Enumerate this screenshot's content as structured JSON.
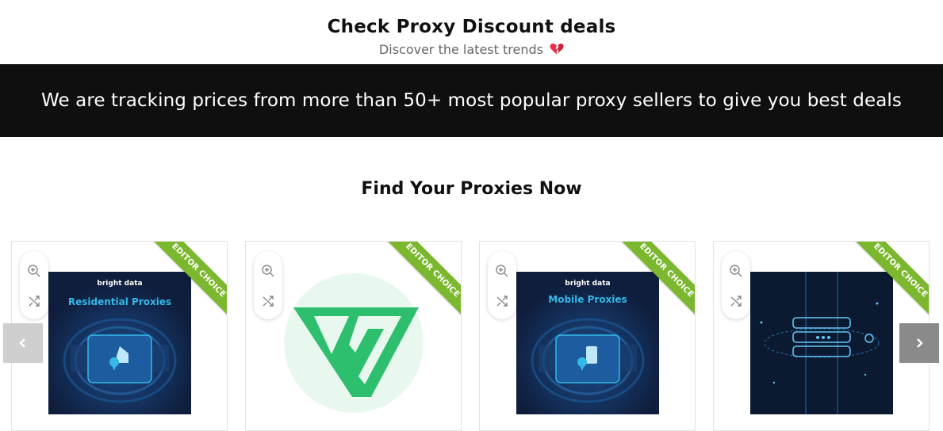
{
  "header": {
    "title": "Check Proxy Discount deals",
    "subtitle": "Discover the latest trends"
  },
  "banner": {
    "text": "We are tracking prices from more than 50+ most popular proxy sellers to give you best deals"
  },
  "section": {
    "title": "Find Your Proxies Now"
  },
  "products": [
    {
      "badge": "EDITOR CHOICE",
      "brand": "bright data",
      "label": "Residential Proxies",
      "image": "bright-data-residential-proxies"
    },
    {
      "badge": "EDITOR CHOICE",
      "image": "green-logo"
    },
    {
      "badge": "EDITOR CHOICE",
      "brand": "bright data",
      "label": "Mobile Proxies",
      "image": "bright-data-mobile-proxies"
    },
    {
      "badge": "EDITOR CHOICE",
      "image": "server-stack-graphic"
    }
  ],
  "colors": {
    "banner_bg": "#0f0f0f",
    "ribbon": "#7cb82f",
    "heart": "#e8334a",
    "dark_navy": "#0f1e3d",
    "accent_cyan": "#34b8e8",
    "logo_green": "#2dbf6e"
  },
  "icons": {
    "zoom": "zoom-in-icon",
    "compare": "shuffle-icon",
    "prev": "chevron-left-icon",
    "next": "chevron-right-icon",
    "heart": "broken-heart-icon"
  }
}
